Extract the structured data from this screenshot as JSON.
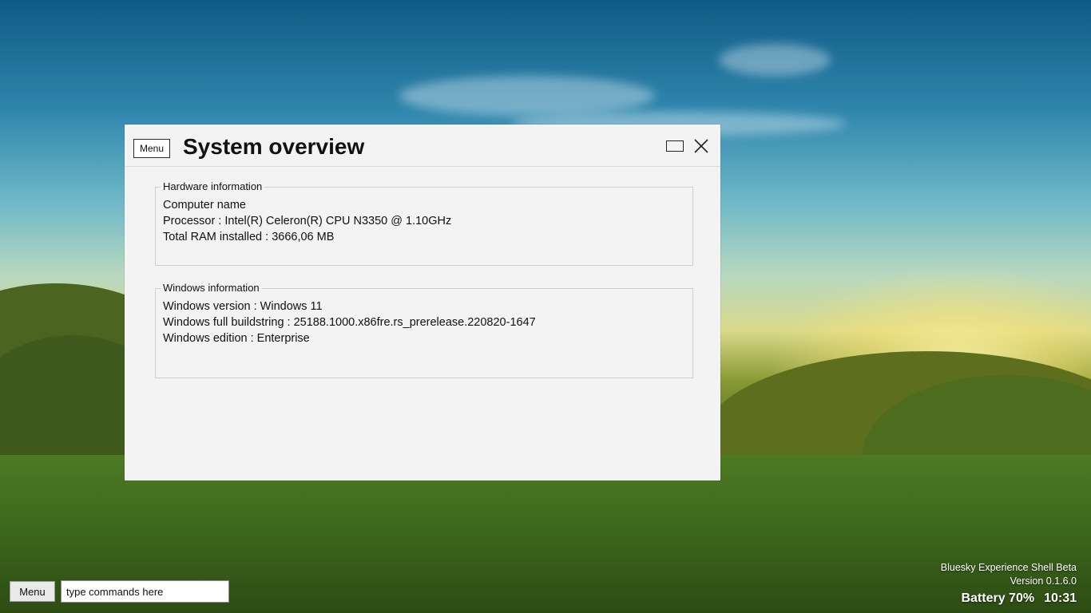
{
  "window": {
    "menu_label": "Menu",
    "title": "System overview",
    "hardware": {
      "legend": "Hardware information",
      "lines": [
        "Computer name",
        "Processor : Intel(R) Celeron(R) CPU N3350 @ 1.10GHz",
        "Total RAM installed : 3666,06 MB"
      ]
    },
    "windows": {
      "legend": "Windows information",
      "lines": [
        "Windows version : Windows 11",
        "Windows full buildstring : 25188.1000.x86fre.rs_prerelease.220820-1647",
        "Windows edition : Enterprise"
      ]
    },
    "icons": {
      "maximize": "maximize-icon",
      "close": "close-icon"
    }
  },
  "taskbar": {
    "menu_label": "Menu",
    "command_placeholder": "type commands here"
  },
  "shell": {
    "name": "Bluesky Experience Shell Beta",
    "version": "Version 0.1.6.0",
    "battery": "Battery 70%",
    "time": "10:31"
  },
  "colors": {
    "window_bg": "#f3f3f3",
    "text": "#111111"
  }
}
